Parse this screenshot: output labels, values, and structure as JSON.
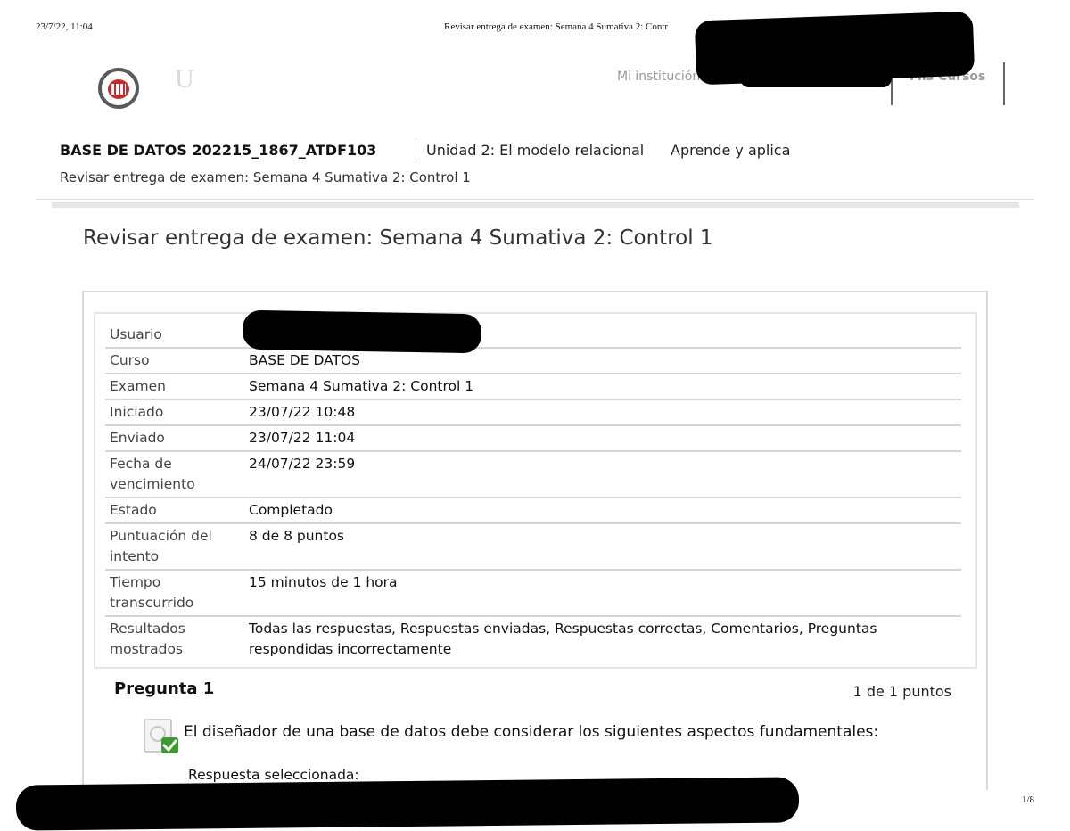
{
  "print_header": {
    "date": "23/7/22, 11:04",
    "title": "Revisar entrega de examen: Semana 4 Sumativa 2: Contr",
    "page": "1/8"
  },
  "top_nav": {
    "institution": "Mi institución",
    "courses": "Mis Cursos"
  },
  "course_header": {
    "course": "BASE DE DATOS 202215_1867_ATDF103",
    "unit": "Unidad 2: El modelo relacional",
    "section": "Aprende y aplica",
    "page": "Revisar entrega de examen: Semana 4 Sumativa 2: Control 1"
  },
  "page_title": "Revisar entrega de examen: Semana 4 Sumativa 2: Control 1",
  "attempt_info": [
    {
      "label": "Usuario",
      "value": ""
    },
    {
      "label": "Curso",
      "value": "BASE DE DATOS"
    },
    {
      "label": "Examen",
      "value": "Semana 4 Sumativa 2: Control 1"
    },
    {
      "label": "Iniciado",
      "value": "23/07/22 10:48"
    },
    {
      "label": "Enviado",
      "value": "23/07/22 11:04"
    },
    {
      "label": "Fecha de vencimiento",
      "value": "24/07/22 23:59"
    },
    {
      "label": "Estado",
      "value": "Completado"
    },
    {
      "label": "Puntuación del intento",
      "value": "8 de 8 puntos"
    },
    {
      "label": "Tiempo transcurrido",
      "value": "15 minutos de 1 hora"
    },
    {
      "label": "Resultados mostrados",
      "value": "Todas las respuestas, Respuestas enviadas, Respuestas correctas, Comentarios, Preguntas respondidas incorrectamente"
    }
  ],
  "question": {
    "title": "Pregunta 1",
    "points": "1 de 1 puntos",
    "text": "El diseñador de una base de datos debe considerar los siguientes aspectos fundamentales:",
    "answer_label": "Respuesta seleccionada:",
    "status_icon": "correct-check-icon"
  }
}
